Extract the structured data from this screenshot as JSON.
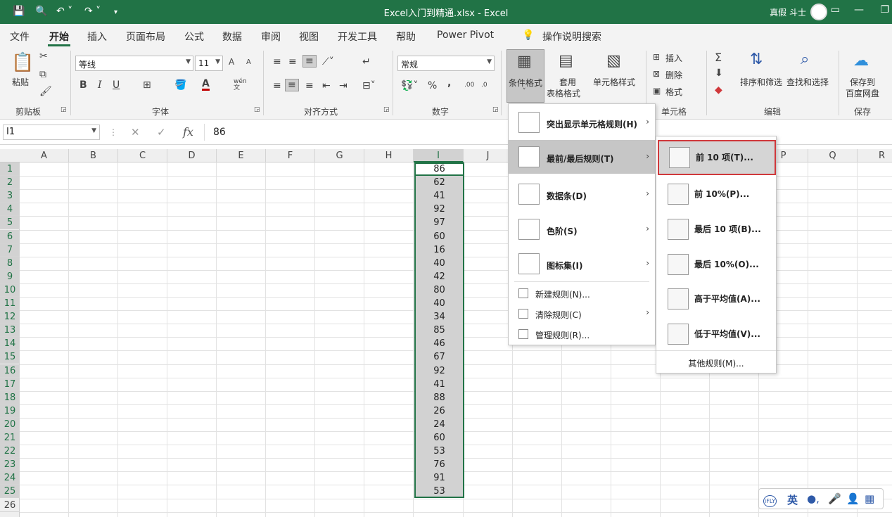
{
  "window": {
    "title": "Excel入门到精通.xlsx  -  Excel",
    "user": "真假 斗士"
  },
  "tabs": [
    "文件",
    "开始",
    "插入",
    "页面布局",
    "公式",
    "数据",
    "审阅",
    "视图",
    "开发工具",
    "帮助",
    "Power Pivot",
    "操作说明搜索"
  ],
  "ribbon": {
    "clipboard": {
      "paste": "粘贴",
      "group": "剪贴板"
    },
    "font": {
      "name": "等线",
      "size": "11",
      "group": "字体",
      "bold": "B",
      "italic": "I",
      "underline": "U",
      "grow": "A",
      "shrink": "A",
      "font_color": "A",
      "wen": "wén 文"
    },
    "alignment": {
      "group": "对齐方式"
    },
    "number": {
      "format": "常规",
      "group": "数字",
      "percent": "%",
      "comma": ","
    },
    "styles": {
      "conditional": "条件格式",
      "table_line1": "套用",
      "table_line2": "表格格式",
      "cell_styles": "单元格样式"
    },
    "cells": {
      "insert": "插入",
      "delete": "删除",
      "format": "格式",
      "group": "单元格"
    },
    "editing": {
      "sort": "排序和筛选",
      "find": "查找和选择",
      "group": "编辑",
      "sum": "Σ"
    },
    "save": {
      "line1": "保存到",
      "line2": "百度网盘",
      "group": "保存"
    }
  },
  "formula_bar": {
    "name_box": "I1",
    "value": "86",
    "fx": "fx"
  },
  "columns": [
    "A",
    "B",
    "C",
    "D",
    "E",
    "F",
    "G",
    "H",
    "I",
    "J",
    "K",
    "L",
    "M",
    "N",
    "O",
    "P",
    "Q",
    "R"
  ],
  "rows": [
    "1",
    "2",
    "3",
    "4",
    "5",
    "6",
    "7",
    "8",
    "9",
    "10",
    "11",
    "12",
    "13",
    "14",
    "15",
    "16",
    "17",
    "18",
    "19",
    "20",
    "21",
    "22",
    "23",
    "24",
    "25",
    "26"
  ],
  "cells_I": [
    "86",
    "62",
    "41",
    "92",
    "97",
    "60",
    "16",
    "40",
    "42",
    "80",
    "40",
    "34",
    "85",
    "46",
    "67",
    "92",
    "41",
    "88",
    "26",
    "24",
    "60",
    "53",
    "76",
    "91",
    "53"
  ],
  "menu_conditional": {
    "items": [
      {
        "label": "突出显示单元格规则(H)",
        "submenu": true
      },
      {
        "label": "最前/最后规则(T)",
        "submenu": true,
        "highlighted": true
      },
      {
        "label": "数据条(D)",
        "submenu": true
      },
      {
        "label": "色阶(S)",
        "submenu": true
      },
      {
        "label": "图标集(I)",
        "submenu": true
      }
    ],
    "small_items": [
      {
        "label": "新建规则(N)...",
        "submenu": false
      },
      {
        "label": "清除规则(C)",
        "submenu": true
      },
      {
        "label": "管理规则(R)...",
        "submenu": false
      }
    ]
  },
  "menu_topbottom": {
    "items": [
      {
        "label": "前 10 项(T)...",
        "icon_text": "10",
        "highlighted": true
      },
      {
        "label": "前 10%(P)...",
        "icon_text": "%"
      },
      {
        "label": "最后 10 项(B)...",
        "icon_text": "10"
      },
      {
        "label": "最后 10%(O)...",
        "icon_text": "%"
      },
      {
        "label": "高于平均值(A)...",
        "icon_text": "x̄"
      },
      {
        "label": "低于平均值(V)...",
        "icon_text": "x̄"
      }
    ],
    "other": "其他规则(M)..."
  },
  "ime": {
    "logo": "iFLY",
    "lang": "英"
  },
  "colors": {
    "excel_green": "#217346",
    "highlight_border": "#d0383b",
    "selection_gray": "#d2d2d2"
  }
}
